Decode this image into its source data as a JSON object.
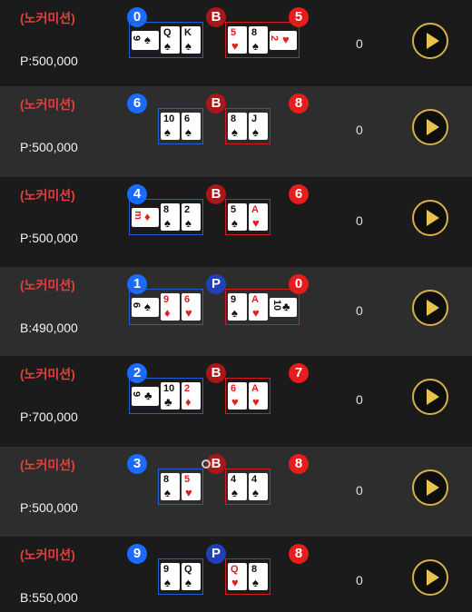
{
  "rows": [
    {
      "mode": "(노커미션)",
      "bet": "P:500,000",
      "score_left": "0",
      "result": "B",
      "score_right": "5",
      "count": "0",
      "left_cards": [
        {
          "r": "9",
          "s": "♠",
          "c": "black",
          "side": true
        },
        {
          "r": "Q",
          "s": "♠",
          "c": "black"
        },
        {
          "r": "K",
          "s": "♠",
          "c": "black"
        }
      ],
      "right_cards": [
        {
          "r": "5",
          "s": "♥",
          "c": "red"
        },
        {
          "r": "8",
          "s": "♠",
          "c": "black"
        },
        {
          "r": "2",
          "s": "♥",
          "c": "red",
          "side": true
        }
      ]
    },
    {
      "mode": "(노커미션)",
      "bet": "P:500,000",
      "score_left": "6",
      "result": "B",
      "score_right": "8",
      "count": "0",
      "left_cards": [
        {
          "r": "10",
          "s": "♠",
          "c": "black"
        },
        {
          "r": "6",
          "s": "♠",
          "c": "black"
        }
      ],
      "right_cards": [
        {
          "r": "8",
          "s": "♠",
          "c": "black"
        },
        {
          "r": "J",
          "s": "♠",
          "c": "black"
        }
      ]
    },
    {
      "mode": "(노커미션)",
      "bet": "P:500,000",
      "score_left": "4",
      "result": "B",
      "score_right": "6",
      "count": "0",
      "left_cards": [
        {
          "r": "m",
          "s": "♦",
          "c": "red",
          "side": true
        },
        {
          "r": "8",
          "s": "♠",
          "c": "black"
        },
        {
          "r": "2",
          "s": "♠",
          "c": "black"
        }
      ],
      "right_cards": [
        {
          "r": "5",
          "s": "♠",
          "c": "black"
        },
        {
          "r": "A",
          "s": "♥",
          "c": "red"
        }
      ]
    },
    {
      "mode": "(노커미션)",
      "bet": "B:490,000",
      "score_left": "1",
      "result": "P",
      "score_right": "0",
      "count": "0",
      "left_cards": [
        {
          "r": "6",
          "s": "♠",
          "c": "black",
          "side": true
        },
        {
          "r": "9",
          "s": "♦",
          "c": "red"
        },
        {
          "r": "6",
          "s": "♥",
          "c": "red"
        }
      ],
      "right_cards": [
        {
          "r": "9",
          "s": "♠",
          "c": "black"
        },
        {
          "r": "A",
          "s": "♥",
          "c": "red"
        },
        {
          "r": "10",
          "s": "♣",
          "c": "black",
          "side": true
        }
      ]
    },
    {
      "mode": "(노커미션)",
      "bet": "P:700,000",
      "score_left": "2",
      "result": "B",
      "score_right": "7",
      "count": "0",
      "left_cards": [
        {
          "r": "9",
          "s": "♣",
          "c": "black",
          "side": true
        },
        {
          "r": "10",
          "s": "♣",
          "c": "black"
        },
        {
          "r": "2",
          "s": "♦",
          "c": "red"
        }
      ],
      "right_cards": [
        {
          "r": "6",
          "s": "♥",
          "c": "red"
        },
        {
          "r": "A",
          "s": "♥",
          "c": "red"
        }
      ]
    },
    {
      "mode": "(노커미션)",
      "bet": "P:500,000",
      "score_left": "3",
      "result": "B",
      "score_right": "8",
      "count": "0",
      "left_cards": [
        {
          "r": "8",
          "s": "♠",
          "c": "black"
        },
        {
          "r": "5",
          "s": "♥",
          "c": "red"
        }
      ],
      "right_cards": [
        {
          "r": "4",
          "s": "♠",
          "c": "black"
        },
        {
          "r": "4",
          "s": "♠",
          "c": "black"
        }
      ]
    },
    {
      "mode": "(노커미션)",
      "bet": "B:550,000",
      "score_left": "9",
      "result": "P",
      "score_right": "8",
      "count": "0",
      "left_cards": [
        {
          "r": "9",
          "s": "♠",
          "c": "black"
        },
        {
          "r": "Q",
          "s": "♠",
          "c": "black"
        }
      ],
      "right_cards": [
        {
          "r": "Q",
          "s": "♥",
          "c": "red"
        },
        {
          "r": "8",
          "s": "♠",
          "c": "black"
        }
      ]
    }
  ],
  "colors": {
    "player": "#1a6bff",
    "banker": "#e81c1c",
    "play_ring": "#d6b14a"
  }
}
